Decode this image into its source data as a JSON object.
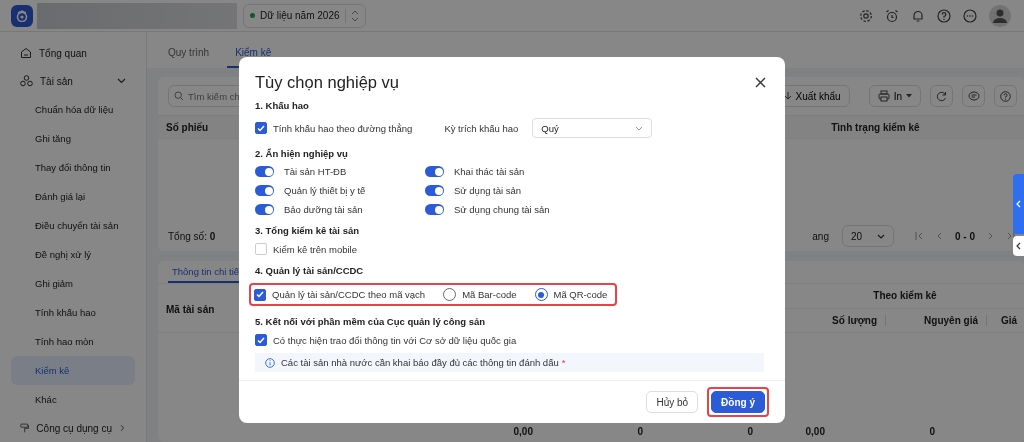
{
  "header": {
    "data_year": "Dữ liệu năm 2026"
  },
  "sidebar": {
    "items": [
      {
        "label": "Tổng quan",
        "kind": "link",
        "selected": false
      },
      {
        "label": "Tài sản",
        "kind": "group",
        "expanded": true,
        "selected": false,
        "children": [
          {
            "label": "Chuẩn hóa dữ liệu",
            "selected": false
          },
          {
            "label": "Ghi tăng",
            "selected": false
          },
          {
            "label": "Thay đổi thông tin",
            "selected": false
          },
          {
            "label": "Đánh giá lại",
            "selected": false
          },
          {
            "label": "Điều chuyển tài sản",
            "selected": false
          },
          {
            "label": "Đề nghị xử lý",
            "selected": false
          },
          {
            "label": "Ghi giảm",
            "selected": false
          },
          {
            "label": "Tính khấu hao",
            "selected": false
          },
          {
            "label": "Tính hao mòn",
            "selected": false
          },
          {
            "label": "Kiểm kê",
            "selected": true
          },
          {
            "label": "Khác",
            "selected": false
          }
        ]
      },
      {
        "label": "Công cụ dụng cụ",
        "kind": "group",
        "expanded": false,
        "selected": false
      }
    ]
  },
  "main": {
    "tabs": [
      {
        "label": "Quy trình",
        "selected": false
      },
      {
        "label": "Kiểm kê",
        "selected": true
      }
    ],
    "search": {
      "placeholder": "Tìm kiếm ch"
    },
    "toolbar": {
      "export": "Xuất khẩu",
      "print": "In"
    },
    "table": {
      "columns": [
        "Số phiếu",
        "Tình trạng kiểm kê"
      ]
    },
    "footer": {
      "total": "Tổng số: **0**",
      "page_label": "ang",
      "page_size": "20",
      "range": "0 - 0"
    },
    "detail": {
      "tabs": [
        {
          "label": "Thông tin chi tiế",
          "selected": true
        }
      ],
      "first_column": "Mã tài sản",
      "group_header": "Theo kiểm kê",
      "columns": [
        "Số lượng",
        "Nguyên giá",
        "Giá"
      ],
      "totals": [
        "0,00",
        "0",
        "0",
        "0,00",
        "0"
      ]
    }
  },
  "dialog": {
    "title": "Tùy chọn nghiệp vụ",
    "sections": [
      {
        "title": "1. Khấu hao",
        "highlighted": false,
        "checkboxes": [
          {
            "label": "Tính khấu hao theo đường thẳng",
            "checked": true
          }
        ],
        "period": {
          "label": "Kỳ trích khấu hao",
          "value": "Quý"
        }
      },
      {
        "title": "2. Ẩn hiện nghiệp vụ",
        "highlighted": false,
        "toggles": [
          {
            "label": "Tài sản HT-ĐB",
            "on": true
          },
          {
            "label": "Khai thác tài sản",
            "on": true
          },
          {
            "label": "Quản lý thiết bị y tế",
            "on": true
          },
          {
            "label": "Sử dụng tài sản",
            "on": true
          },
          {
            "label": "Bảo dưỡng tài sản",
            "on": true
          },
          {
            "label": "Sử dụng chung tài sản",
            "on": true
          }
        ]
      },
      {
        "title": "3. Tổng kiểm kê tài sản",
        "highlighted": false,
        "checkboxes": [
          {
            "label": "Kiểm kê trên mobile",
            "checked": false
          }
        ]
      },
      {
        "title": "4. Quản lý tài sản/CCDC",
        "highlighted": true,
        "checkboxes": [
          {
            "label": "Quản lý tài sản/CCDC theo mã vạch",
            "checked": true
          }
        ],
        "options": [
          {
            "label": "Mã Bar-code",
            "selected": false
          },
          {
            "label": "Mã QR-code",
            "selected": true
          }
        ]
      },
      {
        "title": "5. Kết nối với phần mềm của Cục quản lý công sản",
        "highlighted": false,
        "checkboxes": [
          {
            "label": "Có thực hiện trao đổi thông tin với Cơ sở dữ liệu quốc gia",
            "checked": true
          }
        ],
        "note": {
          "text": "Các tài sản nhà nước cần khai báo đầy đủ các thông tin đánh dấu",
          "required_mark": "*"
        }
      }
    ],
    "buttons": [
      {
        "label": "Hủy bỏ",
        "kind": "secondary",
        "highlighted": false
      },
      {
        "label": "Đồng ý",
        "kind": "primary",
        "highlighted": true
      }
    ]
  }
}
